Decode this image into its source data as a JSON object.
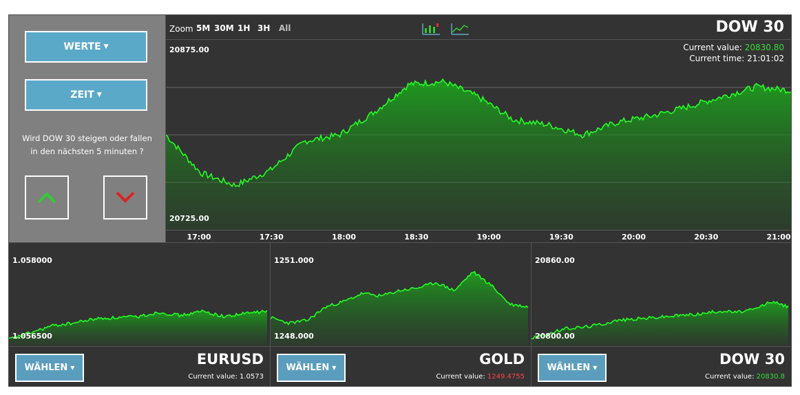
{
  "left_panel": {
    "werte_label": "WERTE",
    "zeit_label": "ZEIT",
    "chevron": "⌄",
    "question_line1": "Wird DOW 30 steigen oder fallen",
    "question_line2": "in den nächsten 5 minuten ?",
    "up_color": "#33cc33",
    "down_color": "#dd2222"
  },
  "main": {
    "zoom_label": "Zoom",
    "zoom_options": [
      "5M",
      "30M",
      "1H",
      "3H",
      "All"
    ],
    "icons": [
      "candlestick-chart-icon",
      "line-chart-icon"
    ],
    "title": "DOW 30",
    "current_value_label": "Current value:",
    "current_value": "20830.80",
    "current_time_label": "Current time:",
    "current_time": "21:01:02",
    "value_color": "#33dd33"
  },
  "chart_data": [
    {
      "type": "area",
      "x": [
        "17:00",
        "17:30",
        "18:00",
        "18:30",
        "19:00",
        "19:30",
        "20:00",
        "20:30",
        "21:00"
      ],
      "ylim": [
        20725.0,
        20875.0
      ],
      "ytick_labels": [
        "20875.00",
        "20725.00"
      ],
      "series": [
        {
          "values": [
            20800,
            20770,
            20760,
            20772,
            20795,
            20800,
            20818,
            20840,
            20842,
            20830,
            20812,
            20808,
            20800,
            20810,
            20815,
            20822,
            20830,
            20838,
            20835
          ]
        }
      ],
      "grid": true
    },
    {
      "type": "area",
      "ylim": [
        1.0565,
        1.058
      ],
      "ytick_labels": [
        "1.058000",
        "1.056500"
      ],
      "series": [
        {
          "values": [
            1.0566,
            1.05672,
            1.05685,
            1.0569,
            1.05698,
            1.057,
            1.05702,
            1.0571,
            1.05704,
            1.05712,
            1.05702,
            1.05708,
            1.05712
          ]
        }
      ]
    },
    {
      "type": "area",
      "ylim": [
        1248.0,
        1251.0
      ],
      "ytick_labels": [
        "1251.000",
        "1248.000"
      ],
      "series": [
        {
          "values": [
            1249.0,
            1248.8,
            1248.9,
            1249.4,
            1249.6,
            1249.9,
            1249.8,
            1250.0,
            1250.1,
            1250.3,
            1250.0,
            1250.7,
            1250.2,
            1249.5,
            1249.4
          ]
        }
      ]
    },
    {
      "type": "area",
      "ylim": [
        20800.0,
        20860.0
      ],
      "ytick_labels": [
        "20860.00",
        "20800.00"
      ],
      "series": [
        {
          "values": [
            20805,
            20808,
            20812,
            20813,
            20815,
            20818,
            20819,
            20820,
            20821,
            20822,
            20823,
            20825,
            20824,
            20826,
            20832,
            20828
          ]
        }
      ]
    }
  ],
  "instruments": [
    {
      "button": "WÄHLEN",
      "symbol": "EURUSD",
      "current_value_label": "Current value:",
      "current_value": "1.0573",
      "value_color": "#ffffff"
    },
    {
      "button": "WÄHLEN",
      "symbol": "GOLD",
      "current_value_label": "Current value:",
      "current_value": "1249.4755",
      "value_color": "#ff4444"
    },
    {
      "button": "WÄHLEN",
      "symbol": "DOW 30",
      "current_value_label": "Current value:",
      "current_value": "20830.8",
      "value_color": "#33dd33"
    }
  ]
}
